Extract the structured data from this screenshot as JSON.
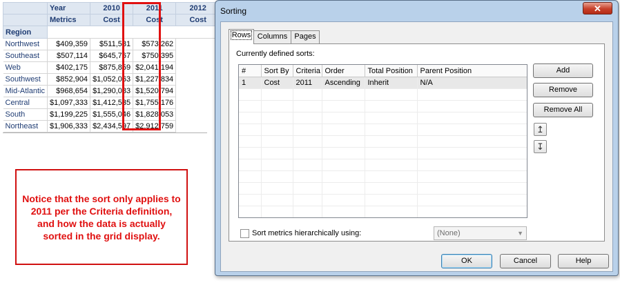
{
  "grid": {
    "header_year_label": "Year",
    "header_metrics_label": "Metrics",
    "header_region_label": "Region",
    "years": [
      "2010",
      "2011",
      "2012"
    ],
    "metric": "Cost",
    "rows": [
      {
        "region": "Northwest",
        "values": [
          "$409,359",
          "$511,581",
          "$573,262"
        ]
      },
      {
        "region": "Southeast",
        "values": [
          "$507,114",
          "$645,767",
          "$750,395"
        ]
      },
      {
        "region": "Web",
        "values": [
          "$402,175",
          "$875,859",
          "$2,041,194"
        ]
      },
      {
        "region": "Southwest",
        "values": [
          "$852,904",
          "$1,052,063",
          "$1,227,834"
        ]
      },
      {
        "region": "Mid-Atlantic",
        "values": [
          "$968,654",
          "$1,290,083",
          "$1,520,794"
        ]
      },
      {
        "region": "Central",
        "values": [
          "$1,097,333",
          "$1,412,535",
          "$1,755,176"
        ]
      },
      {
        "region": "South",
        "values": [
          "$1,199,225",
          "$1,555,046",
          "$1,828,053"
        ]
      },
      {
        "region": "Northeast",
        "values": [
          "$1,906,333",
          "$2,434,597",
          "$2,912,759"
        ]
      }
    ]
  },
  "callout": {
    "text": "Notice that the sort only applies to 2011 per the Criteria definition, and how the data is actually sorted in the grid display."
  },
  "dialog": {
    "title": "Sorting",
    "close_glyph": "✕",
    "tabs": [
      "Rows",
      "Columns",
      "Pages"
    ],
    "active_tab": "Rows",
    "defined_sorts_label": "Currently defined sorts:",
    "columns": [
      "#",
      "Sort By",
      "Criteria",
      "Order",
      "Total Position",
      "Parent Position"
    ],
    "sorts": [
      {
        "num": "1",
        "sort_by": "Cost",
        "criteria": "2011",
        "order": "Ascending",
        "total_position": "Inherit",
        "parent_position": "N/A"
      }
    ],
    "buttons": {
      "add": "Add",
      "remove": "Remove",
      "remove_all": "Remove All",
      "move_up_glyph": "↥",
      "move_down_glyph": "↧",
      "ok": "OK",
      "cancel": "Cancel",
      "help": "Help"
    },
    "hierarchical": {
      "label": "Sort metrics hierarchically using:",
      "checked": false,
      "select_value": "(None)",
      "select_arrow": "▼"
    }
  },
  "colors": {
    "highlight": "#e01010",
    "header_bg": "#dfe7f1",
    "header_text": "#1f3c73",
    "dialog_frame": "#b9d1ea"
  }
}
